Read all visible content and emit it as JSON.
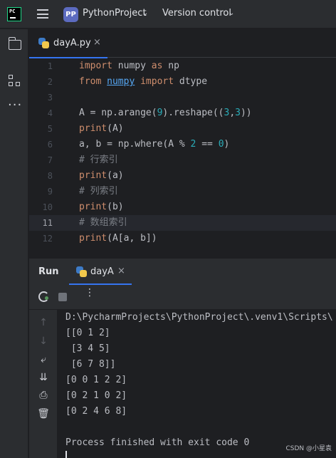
{
  "titlebar": {
    "app_logo": "PC",
    "project_badge": "PP",
    "project_name": "PythonProject",
    "version_control": "Version control"
  },
  "editor_tab": {
    "label": "dayA.py",
    "close": "×"
  },
  "editor": {
    "lines": [
      {
        "n": "1"
      },
      {
        "n": "2"
      },
      {
        "n": "3"
      },
      {
        "n": "4"
      },
      {
        "n": "5"
      },
      {
        "n": "6"
      },
      {
        "n": "7"
      },
      {
        "n": "8"
      },
      {
        "n": "9"
      },
      {
        "n": "10"
      },
      {
        "n": "11"
      },
      {
        "n": "12"
      }
    ],
    "code": {
      "l1_import": "import",
      "l1_mod": " numpy ",
      "l1_as": "as",
      "l1_alias": " np",
      "l2_from": "from",
      "l2_lib": "numpy",
      "l2_import": "import",
      "l2_name": " dtype",
      "l4_a": "A = np.arange(",
      "l4_n1": "9",
      "l4_b": ").reshape((",
      "l4_n2": "3",
      "l4_c": ",",
      "l4_n3": "3",
      "l4_d": "))",
      "l5_print": "print",
      "l5_arg": "(A)",
      "l6_a": "a, b = np.where(A % ",
      "l6_n1": "2",
      "l6_b": " == ",
      "l6_n2": "0",
      "l6_c": ")",
      "l7_comment": "# 行索引",
      "l8_print": "print",
      "l8_arg": "(a)",
      "l9_comment": "# 列索引",
      "l10_print": "print",
      "l10_arg": "(b)",
      "l11_comment": "# 数组索引",
      "l12_print": "print",
      "l12_arg": "(A[a, b])"
    },
    "current_line": "11"
  },
  "run_window": {
    "title": "Run",
    "tab_label": "dayA",
    "tab_close": "×",
    "more": "⋮"
  },
  "console": {
    "lines": [
      "D:\\PycharmProjects\\PythonProject\\.venv1\\Scripts\\",
      "[[0 1 2]",
      " [3 4 5]",
      " [6 7 8]]",
      "[0 0 1 2 2]",
      "[0 2 1 0 2]",
      "[0 2 4 6 8]",
      "",
      "Process finished with exit code 0"
    ]
  },
  "watermark": "CSDN @小星袁",
  "colors": {
    "accent": "#3574f0",
    "keyword": "#cf8e6d",
    "number": "#2aacb8",
    "comment": "#7a7e85",
    "library": "#56a8f5"
  }
}
